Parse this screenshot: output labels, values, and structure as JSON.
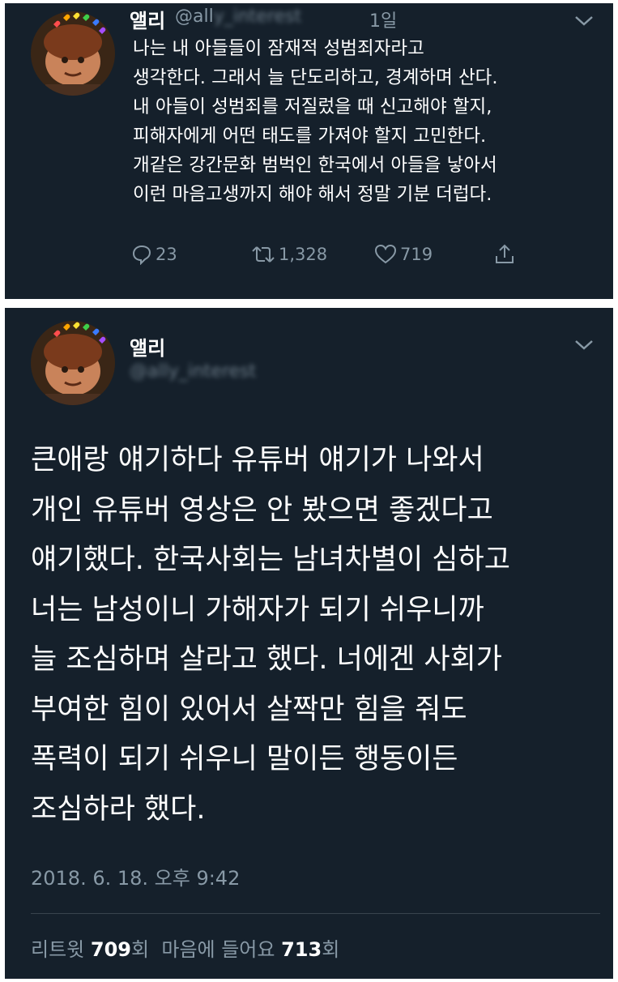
{
  "tweet1": {
    "name": "앨리",
    "handle_prefix": "@all",
    "handle_blurred": "y_interest",
    "age": "1일",
    "lines": [
      "나는 내 아들들이 잠재적 성범죄자라고",
      "생각한다. 그래서 늘 단도리하고, 경계하며 산다.",
      "내 아들이 성범죄를 저질렀을 때 신고해야 할지,",
      "피해자에게 어떤 태도를 가져야 할지 고민한다.",
      "개같은 강간문화 범벅인 한국에서 아들을 낳아서",
      "이런 마음고생까지 해야 해서 정말 기분 더럽다."
    ],
    "reply_count": "23",
    "retweet_count": "1,328",
    "like_count": "719"
  },
  "tweet2": {
    "name": "앨리",
    "handle_blurred": "@ally_interest",
    "lines": [
      "큰애랑 얘기하다 유튜버 얘기가 나와서",
      "개인 유튜버 영상은 안 봤으면 좋겠다고",
      "얘기했다. 한국사회는 남녀차별이 심하고",
      "너는 남성이니 가해자가 되기 쉬우니까",
      "늘 조심하며 살라고 했다. 너에겐 사회가",
      "부여한 힘이 있어서 살짝만 힘을 줘도",
      "폭력이 되기 쉬우니 말이든 행동이든",
      "조심하라 했다."
    ],
    "timestamp": "2018. 6. 18. 오후 9:42",
    "retweet_label": "리트윗",
    "retweet_count": "709",
    "unit": "회",
    "likes_label": "마음에 들어요",
    "likes_count": "713"
  },
  "colors": {
    "background": "#15202b",
    "secondary_text": "#8899a6",
    "divider": "#38444d"
  }
}
